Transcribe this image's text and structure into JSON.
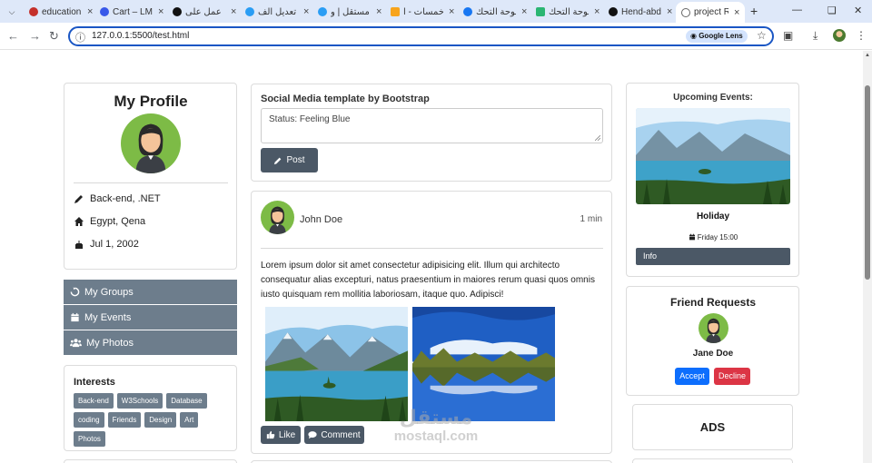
{
  "browser": {
    "tabs": [
      {
        "title": "education",
        "color": "#c4302b"
      },
      {
        "title": "Cart – LMS",
        "color": "#3858e9"
      },
      {
        "title": "عمل على",
        "color": "#111111"
      },
      {
        "title": "تعديل الف",
        "color": "#2a9df4"
      },
      {
        "title": "مستقل | و",
        "color": "#2a9df4"
      },
      {
        "title": "خمسات - ا",
        "color": "#f7a41d"
      },
      {
        "title": "لوحة التحك",
        "color": "#1877f2"
      },
      {
        "title": "لوحة التحك",
        "color": "#2bb673"
      },
      {
        "title": "Hend-abd",
        "color": "#111111"
      },
      {
        "title": "project RV",
        "color": "#666666"
      }
    ],
    "url": "127.0.0.1:5500/test.html",
    "lens_label": "Google Lens"
  },
  "profile": {
    "title": "My Profile",
    "job": "Back-end, .NET",
    "location": "Egypt, Qena",
    "birthday": "Jul 1, 2002"
  },
  "side_menu": [
    "My Groups",
    "My Events",
    "My Photos"
  ],
  "interests": {
    "title": "Interests",
    "tags": [
      "Back-end",
      "W3Schools",
      "Database",
      "coding",
      "Friends",
      "Design",
      "Art",
      "Photos"
    ]
  },
  "composer": {
    "heading": "Social Media template by Bootstrap",
    "status": "Status: Feeling Blue",
    "post_label": "Post"
  },
  "feed_post": {
    "author": "John Doe",
    "time": "1 min",
    "text": "Lorem ipsum dolor sit amet consectetur adipisicing elit. Illum qui architecto consequatur alias excepturi, natus praesentium in maiores rerum quasi quos omnis iusto quisquam rem mollitia laboriosam, itaque quo. Adipisci!",
    "like_label": "Like",
    "comment_label": "Comment"
  },
  "events": {
    "title": "Upcoming Events:",
    "name": "Holiday",
    "date": "Friday 15:00",
    "info_label": "Info"
  },
  "friend_requests": {
    "title": "Friend Requests",
    "name": "Jane Doe",
    "accept_label": "Accept",
    "decline_label": "Decline"
  },
  "ads_label": "ADS",
  "watermark": {
    "arabic": "مستقل",
    "latin": "mostaql.com"
  }
}
